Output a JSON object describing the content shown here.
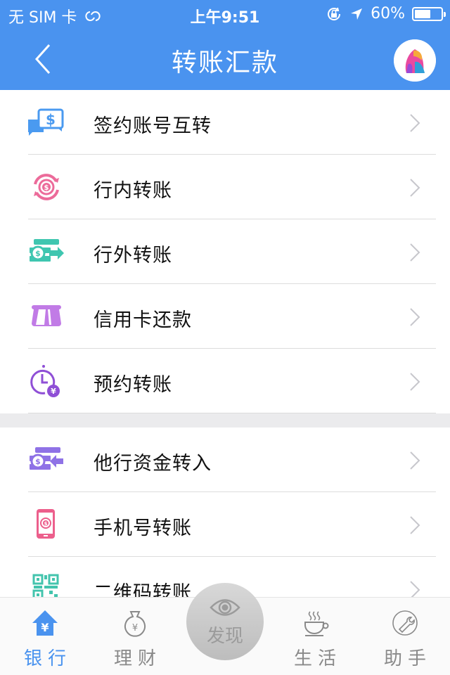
{
  "status_bar": {
    "carrier": "无 SIM 卡",
    "time": "上午9:51",
    "battery_percent_label": "60%",
    "battery_level": 0.6
  },
  "nav": {
    "title": "转账汇款",
    "back_icon": "chevron-left-icon",
    "avatar_icon": "user-avatar"
  },
  "sections": [
    {
      "items": [
        {
          "label": "签约账号互转",
          "icon": "chat-dollar-icon",
          "color": "#4a9af0"
        },
        {
          "label": "行内转账",
          "icon": "cycle-dollar-icon",
          "color": "#ec6b9a"
        },
        {
          "label": "行外转账",
          "icon": "transfer-out-icon",
          "color": "#3fc6b0"
        },
        {
          "label": "信用卡还款",
          "icon": "card-repay-icon",
          "color": "#c17be6"
        },
        {
          "label": "预约转账",
          "icon": "clock-yen-icon",
          "color": "#8f4fd6"
        }
      ]
    },
    {
      "items": [
        {
          "label": "他行资金转入",
          "icon": "transfer-in-icon",
          "color": "#8f72e6"
        },
        {
          "label": "手机号转账",
          "icon": "phone-dollar-icon",
          "color": "#ec5f8c"
        },
        {
          "label": "二维码转账",
          "icon": "qr-code-icon",
          "color": "#43c4ad"
        }
      ]
    }
  ],
  "tab_bar": {
    "tabs": [
      {
        "label": "银行",
        "icon": "bank-house-icon",
        "active": true
      },
      {
        "label": "理财",
        "icon": "money-bag-icon",
        "active": false
      },
      {
        "label": "生活",
        "icon": "coffee-cup-icon",
        "active": false
      },
      {
        "label": "助手",
        "icon": "wrench-icon",
        "active": false
      }
    ],
    "discover": {
      "label": "发现",
      "icon": "eye-icon"
    }
  },
  "colors": {
    "brand_blue": "#4a93ef",
    "tab_inactive": "#8a8a8a",
    "section_gap": "#ebebed"
  }
}
